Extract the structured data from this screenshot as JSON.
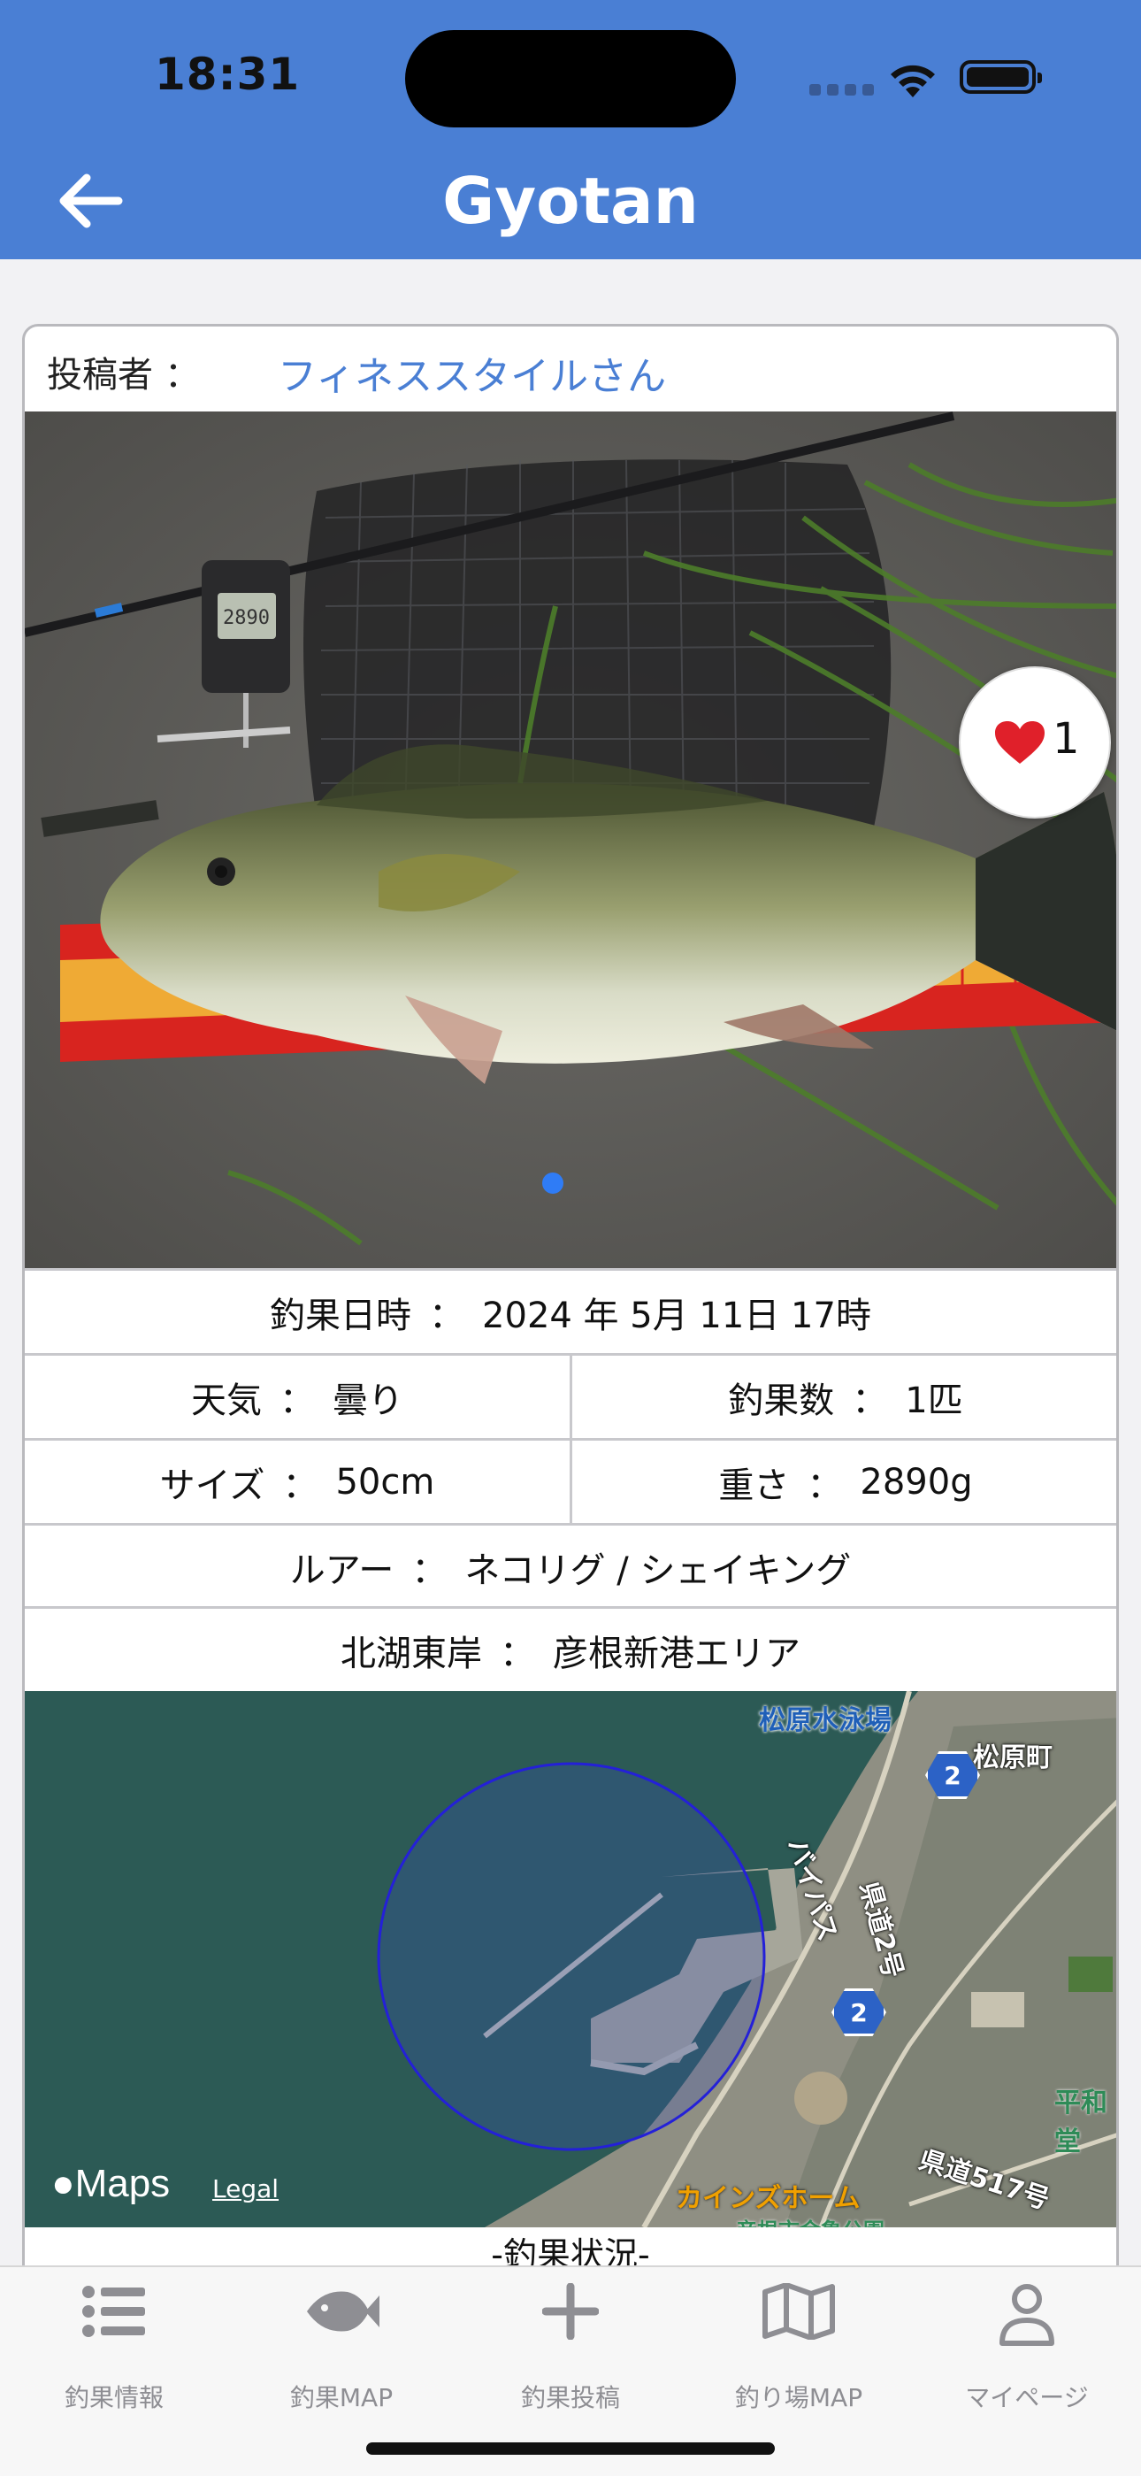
{
  "status_bar": {
    "time": "18:31"
  },
  "nav": {
    "title": "Gyotan"
  },
  "post": {
    "poster_label": "投稿者",
    "poster_colon": "：",
    "poster_name": "フィネススタイルさん",
    "likes": "1",
    "date_label": "釣果日時",
    "date_value": "2024 年 5月 11日 17時",
    "weather_label": "天気",
    "weather_value": "曇り",
    "count_label": "釣果数",
    "count_value": "1匹",
    "size_label": "サイズ",
    "size_value": "50cm",
    "weight_label": "重さ",
    "weight_value": "2890g",
    "lure_label": "ルアー",
    "lure_value": "ネコリグ / シェイキング",
    "area_label": "北湖東岸",
    "area_value": "彦根新港エリア",
    "separator": "：",
    "status_caption": "-釣果状況-"
  },
  "map": {
    "labels": {
      "beach": "松原水泳場",
      "town": "松原町",
      "route2a": "2",
      "route2b": "2",
      "pref_road": "県道2号",
      "bypass": "バイパス",
      "store": "カインズホーム",
      "heiwa": "平和堂",
      "pref_road_517": "県道517号",
      "park": "彦根市金亀公園"
    },
    "brand": "Maps",
    "legal": "Legal"
  },
  "tabbar": {
    "items": [
      {
        "label": "釣果情報",
        "icon": "list-icon"
      },
      {
        "label": "釣果MAP",
        "icon": "fish-icon"
      },
      {
        "label": "釣果投稿",
        "icon": "plus-icon"
      },
      {
        "label": "釣り場MAP",
        "icon": "map-icon"
      },
      {
        "label": "マイページ",
        "icon": "person-icon"
      }
    ]
  },
  "colors": {
    "header": "#4a7fd4",
    "link": "#4a7fd4",
    "heart": "#e0202a",
    "tab_inactive": "#8e8e93"
  }
}
